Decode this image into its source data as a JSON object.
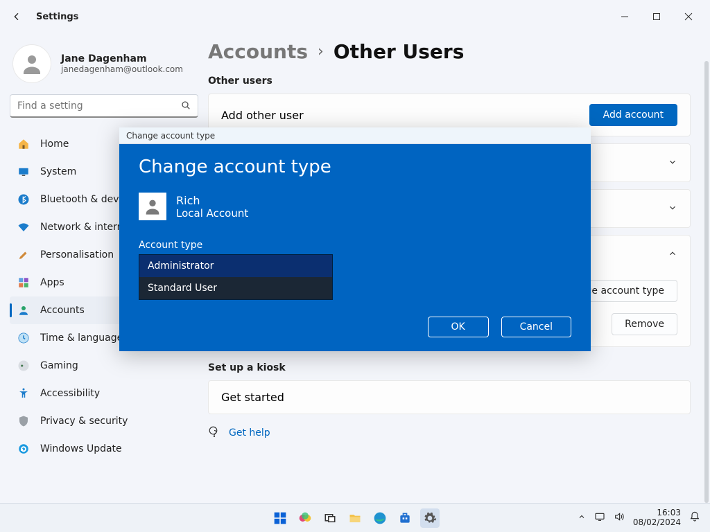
{
  "window": {
    "title": "Settings"
  },
  "user": {
    "name": "Jane Dagenham",
    "email": "janedagenham@outlook.com"
  },
  "search": {
    "placeholder": "Find a setting"
  },
  "nav": {
    "items": [
      {
        "label": "Home",
        "icon": "home"
      },
      {
        "label": "System",
        "icon": "system"
      },
      {
        "label": "Bluetooth & devices",
        "icon": "bluetooth"
      },
      {
        "label": "Network & internet",
        "icon": "wifi"
      },
      {
        "label": "Personalisation",
        "icon": "brush"
      },
      {
        "label": "Apps",
        "icon": "apps"
      },
      {
        "label": "Accounts",
        "icon": "accounts",
        "active": true
      },
      {
        "label": "Time & language",
        "icon": "clock"
      },
      {
        "label": "Gaming",
        "icon": "gaming"
      },
      {
        "label": "Accessibility",
        "icon": "accessibility"
      },
      {
        "label": "Privacy & security",
        "icon": "shield"
      },
      {
        "label": "Windows Update",
        "icon": "update"
      }
    ]
  },
  "breadcrumb": {
    "parent": "Accounts",
    "current": "Other Users"
  },
  "sections": {
    "other_users": {
      "heading": "Other users",
      "add_label": "Add other user",
      "add_button": "Add account",
      "change_type_button": "Change account type",
      "remove_button": "Remove"
    },
    "kiosk": {
      "heading": "Set up a kiosk",
      "get_started": "Get started"
    }
  },
  "help": {
    "label": "Get help"
  },
  "modal": {
    "titlebar": "Change account type",
    "heading": "Change account type",
    "account_name": "Rich",
    "account_kind": "Local Account",
    "dropdown_label": "Account type",
    "options": [
      "Administrator",
      "Standard User"
    ],
    "selected": "Administrator",
    "ok": "OK",
    "cancel": "Cancel"
  },
  "taskbar": {
    "time": "16:03",
    "date": "08/02/2024"
  }
}
